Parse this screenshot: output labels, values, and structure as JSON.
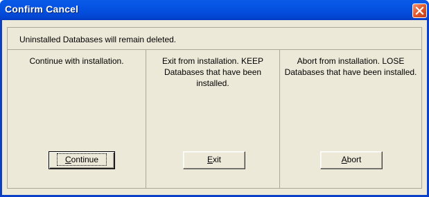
{
  "window": {
    "title": "Confirm Cancel",
    "close_icon": "close-x-icon"
  },
  "message": "Uninstalled Databases will remain deleted.",
  "options": [
    {
      "description": "Continue with installation.",
      "button_mnemonic": "C",
      "button_rest": "ontinue"
    },
    {
      "description": "Exit from installation. KEEP Databases that have been installed.",
      "button_mnemonic": "E",
      "button_rest": "xit"
    },
    {
      "description": "Abort from installation. LOSE Databases that have been installed.",
      "button_mnemonic": "A",
      "button_rest": "bort"
    }
  ],
  "colors": {
    "titlebar": "#0450e0",
    "client": "#ece9d8",
    "close_button": "#e35b2f"
  }
}
